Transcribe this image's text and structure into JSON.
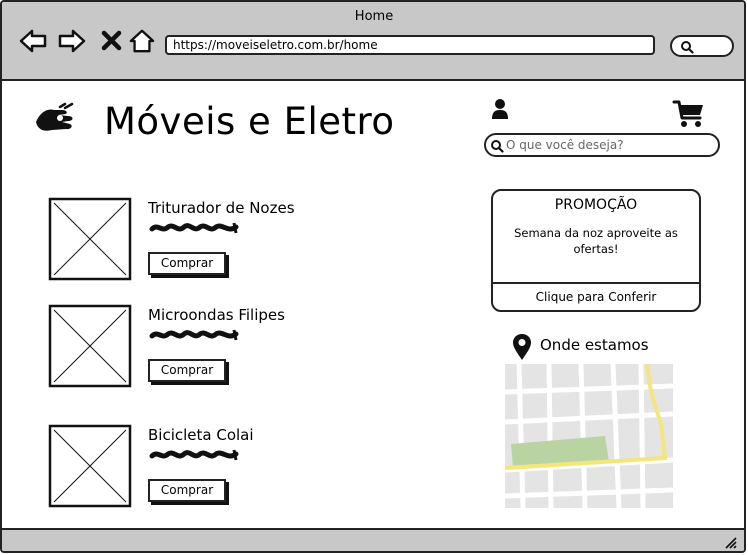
{
  "window": {
    "title": "Home"
  },
  "browser": {
    "url": "https://moveiseletro.com.br/home",
    "nav_icons": [
      "back-arrow-icon",
      "forward-arrow-icon",
      "close-x-icon",
      "home-icon"
    ]
  },
  "header": {
    "logo_icon": "hand-sign-icon",
    "site_title": "Móveis e Eletro",
    "search_placeholder": "O que você deseja?"
  },
  "products": [
    {
      "name": "Triturador de Nozes",
      "button": "Comprar"
    },
    {
      "name": "Microondas Filipes",
      "button": "Comprar"
    },
    {
      "name": "Bicicleta Colai",
      "button": "Comprar"
    }
  ],
  "promo": {
    "title": "PROMOÇÃO",
    "text": "Semana da noz aproveite as ofertas!",
    "link": "Clique para Conferir"
  },
  "location": {
    "title": "Onde estamos"
  },
  "colors": {
    "chrome": "#c8c8c8",
    "border": "#222222",
    "map_bg": "#e4e4e4",
    "map_road": "#f4e67a",
    "map_park": "#b9d3a3"
  }
}
